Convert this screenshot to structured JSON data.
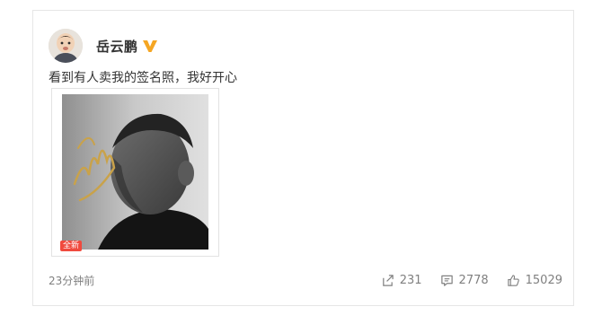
{
  "post": {
    "author": "岳云鹏",
    "text": "看到有人卖我的签名照，我好开心",
    "badge": "全新",
    "timestamp": "23分钟前",
    "stats": {
      "repost_count": "231",
      "comment_count": "2778",
      "like_count": "15029"
    }
  },
  "icons": {
    "verified": "verified-v-icon",
    "repost": "share-icon",
    "comment": "comment-icon",
    "like": "thumbs-up-icon"
  },
  "colors": {
    "verified": "#f5a623",
    "badge": "#f04a3e",
    "meta_text": "#808080"
  }
}
